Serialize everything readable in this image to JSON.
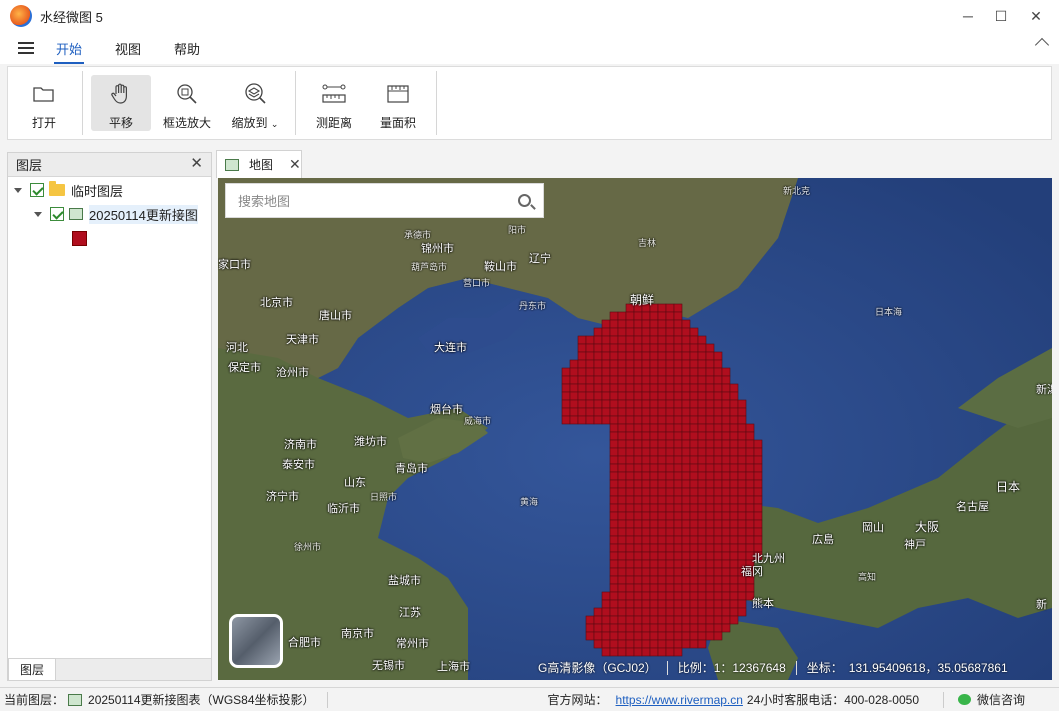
{
  "app": {
    "title": "水经微图 5"
  },
  "window_controls": {
    "minimize": "─",
    "maximize": "☐",
    "close": "✕"
  },
  "menu": {
    "tabs": [
      "开始",
      "视图",
      "帮助"
    ],
    "active": "开始"
  },
  "ribbon": {
    "buttons": [
      {
        "label": "打开",
        "icon": "folder-open-icon"
      },
      {
        "label": "平移",
        "icon": "hand-pan-icon",
        "active": true
      },
      {
        "label": "框选放大",
        "icon": "zoom-box-icon"
      },
      {
        "label": "缩放到",
        "icon": "zoom-to-layers-icon",
        "dropdown": true
      },
      {
        "label": "测距离",
        "icon": "measure-distance-icon"
      },
      {
        "label": "量面积",
        "icon": "measure-area-icon"
      }
    ]
  },
  "layer_panel": {
    "title": "图层",
    "tree": [
      {
        "label": "临时图层",
        "checked": true,
        "type": "folder"
      },
      {
        "label": "20250114更新接图",
        "checked": true,
        "type": "layer",
        "swatch_color": "#b00e1e"
      }
    ],
    "bottom_tab": "图层"
  },
  "map_tab": {
    "label": "地图"
  },
  "map": {
    "search_placeholder": "搜索地图",
    "labels": [
      "锦州市",
      "葫芦岛市",
      "辽宁",
      "鞍山市",
      "营口市",
      "丹东市",
      "朝鲜",
      "北京市",
      "唐山市",
      "天津市",
      "大连市",
      "河北",
      "保定市",
      "沧州市",
      "烟台市",
      "威海市",
      "济南市",
      "潍坊市",
      "泰安市",
      "山东",
      "青岛市",
      "日照市",
      "临沂市",
      "济宁市",
      "徐州市",
      "盐城市",
      "江苏",
      "合肥市",
      "南京市",
      "常州市",
      "无锡市",
      "上海市",
      "北九州",
      "福冈",
      "広島",
      "岡山",
      "神戸",
      "大阪",
      "名古屋",
      "日本",
      "熊本",
      "高知",
      "新潟",
      "日本海",
      "黄海",
      "家口市",
      "阳市",
      "吉林",
      "新北克",
      "新",
      "承德市"
    ],
    "status": {
      "source": "G高清影像（GCJ02）",
      "scale_label": "比例：",
      "scale_value": "1：12367648",
      "coord_label": "坐标：",
      "coord_value": "131.95409618，35.05687861"
    }
  },
  "statusbar": {
    "current_layer_label": "当前图层：",
    "current_layer_value": "20250114更新接图表（WGS84坐标投影）",
    "site_label": "官方网站：",
    "site_url": "https://www.rivermap.cn",
    "hotline": "24小时客服电话：400-028-0050",
    "wechat": "微信咨询"
  },
  "colors": {
    "accent": "#1e5fc0",
    "grid_fill": "#b00e1e",
    "sea": "#2e4c8e",
    "land": "#4f5f3a"
  }
}
